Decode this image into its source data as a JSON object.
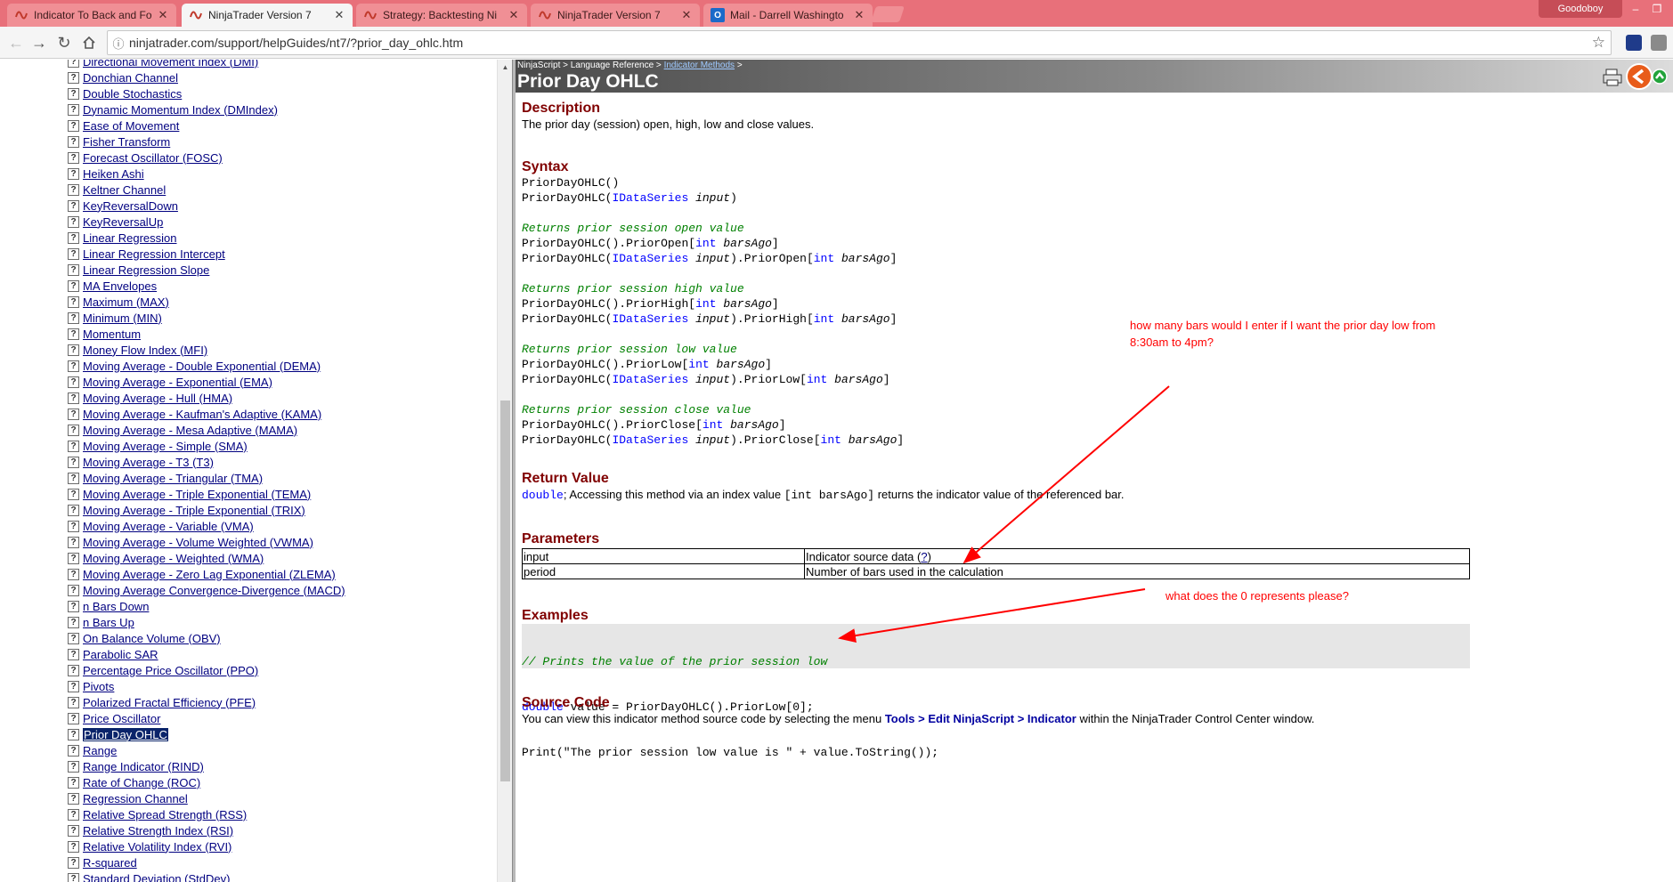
{
  "browser": {
    "tabs": [
      {
        "title": "Indicator To Back and Fo",
        "icon": "ninjatrader-icon",
        "active": false
      },
      {
        "title": "NinjaTrader Version 7",
        "icon": "ninjatrader-icon",
        "active": true
      },
      {
        "title": "Strategy: Backtesting Ni",
        "icon": "ninjatrader-icon",
        "active": false
      },
      {
        "title": "NinjaTrader Version 7",
        "icon": "ninjatrader-icon",
        "active": false
      },
      {
        "title": "Mail - Darrell Washingto",
        "icon": "outlook-icon",
        "active": false
      }
    ],
    "user_name": "Goodoboy",
    "url": "ninjatrader.com/support/helpGuides/nt7/?prior_day_ohlc.htm",
    "colors": {
      "tabbar": "#e8707a",
      "active_tab": "#f5f5f5"
    }
  },
  "toc": {
    "items": [
      "Directional Movement Index (DMI)",
      "Donchian Channel",
      "Double Stochastics",
      "Dynamic Momentum Index (DMIndex)",
      "Ease of Movement",
      "Fisher Transform",
      "Forecast Oscillator (FOSC)",
      "Heiken Ashi",
      "Keltner Channel",
      "KeyReversalDown",
      "KeyReversalUp",
      "Linear Regression",
      "Linear Regression Intercept",
      "Linear Regression Slope",
      "MA Envelopes",
      "Maximum (MAX)",
      "Minimum (MIN)",
      "Momentum",
      "Money Flow Index (MFI)",
      "Moving Average - Double Exponential (DEMA)",
      "Moving Average - Exponential (EMA)",
      "Moving Average - Hull (HMA)",
      "Moving Average - Kaufman's Adaptive (KAMA)",
      "Moving Average - Mesa Adaptive (MAMA)",
      "Moving Average - Simple (SMA)",
      "Moving Average - T3 (T3)",
      "Moving Average - Triangular (TMA)",
      "Moving Average - Triple Exponential (TEMA)",
      "Moving Average - Triple Exponential (TRIX)",
      "Moving Average - Variable (VMA)",
      "Moving Average - Volume Weighted (VWMA)",
      "Moving Average - Weighted (WMA)",
      "Moving Average - Zero Lag Exponential (ZLEMA)",
      "Moving Average Convergence-Divergence (MACD)",
      "n Bars Down",
      "n Bars Up",
      "On Balance Volume (OBV)",
      "Parabolic SAR",
      "Percentage Price Oscillator (PPO)",
      "Pivots",
      "Polarized Fractal Efficiency (PFE)",
      "Price Oscillator",
      "Prior Day OHLC",
      "Range",
      "Range Indicator (RIND)",
      "Rate of Change (ROC)",
      "Regression Channel",
      "Relative Spread Strength (RSS)",
      "Relative Strength Index (RSI)",
      "Relative Volatility Index (RVI)",
      "R-squared",
      "Standard Deviation (StdDev)"
    ],
    "selected": "Prior Day OHLC",
    "item_icon_glyph": "?"
  },
  "page": {
    "breadcrumb": {
      "part1": "NinjaScript > Language Reference > ",
      "link": "Indicator Methods",
      "sep": " >"
    },
    "title": "Prior Day OHLC",
    "description": {
      "heading": "Description",
      "text": "The prior day (session) open, high, low and close values."
    },
    "syntax": {
      "heading": "Syntax",
      "fn": "PriorDayOHLC",
      "type": "IDataSeries",
      "input": "input",
      "int": "int",
      "barsago": "barsAgo",
      "groups": [
        {
          "comment": "Returns prior session open value",
          "prop": "PriorOpen"
        },
        {
          "comment": "Returns prior session high value",
          "prop": "PriorHigh"
        },
        {
          "comment": "Returns prior session low value",
          "prop": "PriorLow"
        },
        {
          "comment": "Returns prior session close value",
          "prop": "PriorClose"
        }
      ]
    },
    "return_value": {
      "heading": "Return Value",
      "type": "double",
      "text1": "; Accessing this method via an index value ",
      "code": "[int barsAgo]",
      "text2": " returns the indicator value of the referenced bar."
    },
    "parameters": {
      "heading": "Parameters",
      "rows": [
        {
          "name": "input",
          "desc": "Indicator source data (",
          "link": "?",
          "desc_end": ")"
        },
        {
          "name": "period",
          "desc": "Number of bars used in the calculation",
          "link": "",
          "desc_end": ""
        }
      ]
    },
    "examples": {
      "heading": "Examples",
      "line1": "// Prints the value of the prior session low",
      "line2_kw": "double",
      "line2_rest": " value = PriorDayOHLC().PriorLow[0];",
      "line3": "Print(\"The prior session low value is \" + value.ToString());"
    },
    "source_code": {
      "heading": "Source Code",
      "text1": "You can view this indicator method source code by selecting the menu ",
      "menu": "Tools > Edit NinjaScript > Indicator",
      "text2": " within the NinjaTrader Control Center window."
    }
  },
  "annotations": {
    "note1_line1": "how many bars would I enter if I want the prior day low from",
    "note1_line2": "8:30am to 4pm?",
    "note2": "what does the 0 represents please?",
    "color": "#ff0000"
  }
}
